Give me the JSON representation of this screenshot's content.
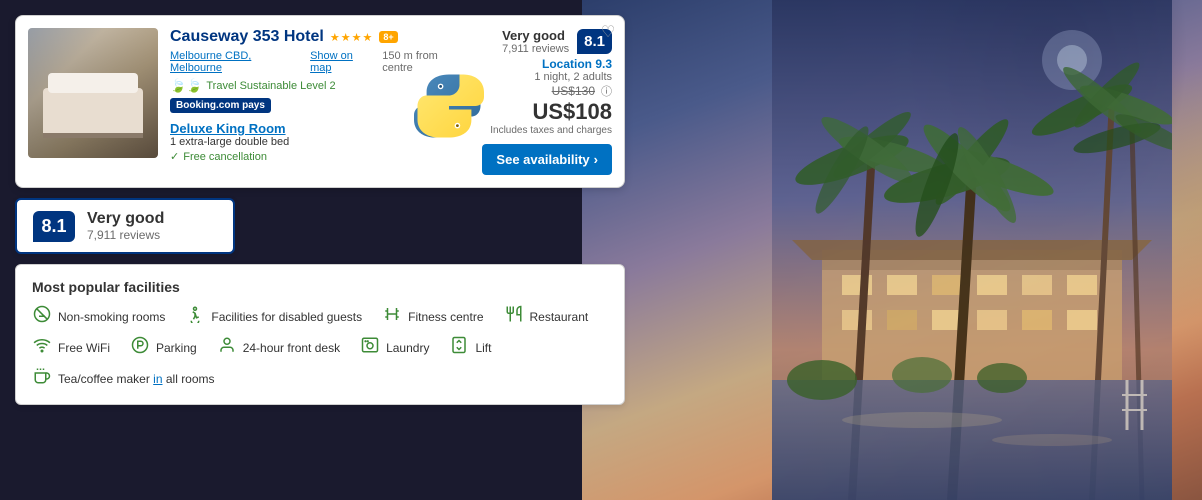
{
  "background": {
    "gradient_start": "#2c3e6b",
    "gradient_end": "#8a5540"
  },
  "hotel_card": {
    "name": "Causeway 353 Hotel",
    "stars_count": 4,
    "award_label": "8+",
    "location_text": "Melbourne CBD, Melbourne",
    "show_on_map": "Show on map",
    "distance": "150 m from centre",
    "sustainable_label": "Travel Sustainable Level 2",
    "booking_pays_label": "Booking.com pays",
    "room_type": "Deluxe King Room",
    "bed_type": "1 extra-large double bed",
    "cancellation_label": "Free cancellation",
    "nights_adults": "1 night, 2 adults",
    "original_price": "US$130",
    "current_price": "US$108",
    "taxes_label": "Includes taxes and charges",
    "availability_btn": "See availability",
    "review_label": "Very good",
    "review_count": "7,911 reviews",
    "review_score": "8.1",
    "location_score": "Location 9.3"
  },
  "score_card": {
    "score": "8.1",
    "label": "Very good",
    "reviews": "7,911 reviews"
  },
  "facilities": {
    "title": "Most popular facilities",
    "items_row1": [
      {
        "icon": "🚭",
        "label": "Non-smoking rooms"
      },
      {
        "icon": "♿",
        "label": "Facilities for disabled guests"
      },
      {
        "icon": "🏋",
        "label": "Fitness centre"
      },
      {
        "icon": "🍴",
        "label": "Restaurant"
      }
    ],
    "items_row2": [
      {
        "icon": "📶",
        "label": "Free WiFi"
      },
      {
        "icon": "🅿",
        "label": "Parking"
      },
      {
        "icon": "🛎",
        "label": "24-hour front desk"
      },
      {
        "icon": "🧺",
        "label": "Laundry"
      },
      {
        "icon": "🛗",
        "label": "Lift"
      }
    ],
    "items_row3": [
      {
        "icon": "☕",
        "label": "Tea/coffee maker",
        "suffix": " in all rooms",
        "suffix_link": true
      }
    ]
  }
}
